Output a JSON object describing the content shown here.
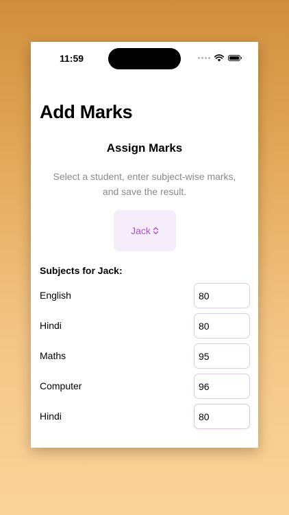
{
  "status_bar": {
    "time": "11:59"
  },
  "page": {
    "title": "Add Marks"
  },
  "assign": {
    "title": "Assign Marks",
    "description": "Select a student, enter subject-wise marks, and save the result."
  },
  "student_picker": {
    "selected": "Jack",
    "accent_color": "#ad4fcc"
  },
  "subjects": {
    "heading": "Subjects for Jack:",
    "items": [
      {
        "name": "English",
        "marks": "80"
      },
      {
        "name": "Hindi",
        "marks": "80"
      },
      {
        "name": "Maths",
        "marks": "95"
      },
      {
        "name": "Computer",
        "marks": "96"
      },
      {
        "name": "Hindi",
        "marks": "80"
      }
    ]
  },
  "icons": {
    "signal": "cellular-dots-icon",
    "wifi": "wifi-icon",
    "battery": "battery-icon",
    "picker_chevron": "chevron-up-down-icon"
  }
}
